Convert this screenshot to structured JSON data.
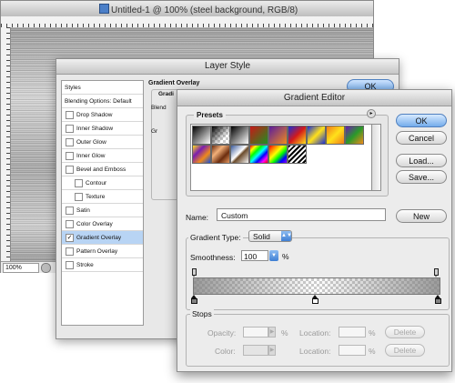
{
  "document": {
    "title": "Untitled-1 @ 100% (steel background, RGB/8)",
    "zoom": "100%"
  },
  "layer_style": {
    "title": "Layer Style",
    "list_header": "Styles",
    "blending_options": "Blending Options: Default",
    "items": [
      {
        "label": "Drop Shadow",
        "checked": false,
        "indent": false
      },
      {
        "label": "Inner Shadow",
        "checked": false,
        "indent": false
      },
      {
        "label": "Outer Glow",
        "checked": false,
        "indent": false
      },
      {
        "label": "Inner Glow",
        "checked": false,
        "indent": false
      },
      {
        "label": "Bevel and Emboss",
        "checked": false,
        "indent": false
      },
      {
        "label": "Contour",
        "checked": false,
        "indent": true
      },
      {
        "label": "Texture",
        "checked": false,
        "indent": true
      },
      {
        "label": "Satin",
        "checked": false,
        "indent": false
      },
      {
        "label": "Color Overlay",
        "checked": false,
        "indent": false
      },
      {
        "label": "Gradient Overlay",
        "checked": true,
        "indent": false,
        "selected": true
      },
      {
        "label": "Pattern Overlay",
        "checked": false,
        "indent": false
      },
      {
        "label": "Stroke",
        "checked": false,
        "indent": false
      }
    ],
    "section_title": "Gradient Overlay",
    "group_title": "Gradi",
    "blend_label": "Blend",
    "gr_label": "Gr",
    "ok_label": "OK"
  },
  "gradient_editor": {
    "title": "Gradient Editor",
    "presets_label": "Presets",
    "presets_menu_glyph": "▸",
    "presets": [
      {
        "name": "Foreground to Background",
        "css": "linear-gradient(135deg,#000,#fff)"
      },
      {
        "name": "Foreground to Transparent",
        "css": "linear-gradient(135deg,#000,rgba(0,0,0,0) 70%), repeating-conic-gradient(#ccc 0 25%,#fff 0 50%) 0 0/6px 6px"
      },
      {
        "name": "Black, White",
        "css": "linear-gradient(135deg,#000,#fff)"
      },
      {
        "name": "Red, Green",
        "css": "linear-gradient(135deg,#c81818,#1f8f1f)"
      },
      {
        "name": "Violet, Orange",
        "css": "linear-gradient(135deg,#5a1d9c,#f08a1d)"
      },
      {
        "name": "Blue, Red, Yellow",
        "css": "linear-gradient(135deg,#1a2fd6,#d41a1a,#ffe11a)"
      },
      {
        "name": "Blue, Yellow, Blue",
        "css": "linear-gradient(135deg,#1a2fd6,#ffe11a,#1a2fd6)"
      },
      {
        "name": "Orange, Yellow, Orange",
        "css": "linear-gradient(135deg,#f07a1a,#ffe11a,#f07a1a)"
      },
      {
        "name": "Violet, Green, Orange",
        "css": "linear-gradient(135deg,#6a1db0,#2a9a2a,#f08a1a)"
      },
      {
        "name": "Yellow, Violet, Orange, Blue",
        "css": "linear-gradient(135deg,#ffe11a,#7a1db0,#f08a1a,#1a4fd6)"
      },
      {
        "name": "Copper",
        "css": "linear-gradient(135deg,#6b2c0e,#f2b07a,#6b2c0e,#e69a62)"
      },
      {
        "name": "Chrome",
        "css": "linear-gradient(135deg,#3a5a9a,#ffffff 45%,#6a4a2a 55%,#f5f5f5)"
      },
      {
        "name": "Spectrum",
        "css": "linear-gradient(135deg,#f00,#ff0,#0f0,#0ff,#00f,#f0f,#f00)"
      },
      {
        "name": "Transparent Rainbow",
        "css": "linear-gradient(135deg,#f00,#f80,#ff0,#0f0,#00f,#80f)"
      },
      {
        "name": "Transparent Stripes",
        "css": "repeating-linear-gradient(135deg,#000 0 2px,#fff 2px 4px)"
      }
    ],
    "buttons": {
      "ok": "OK",
      "cancel": "Cancel",
      "load": "Load...",
      "save": "Save...",
      "new": "New"
    },
    "name_label": "Name:",
    "name_value": "Custom",
    "gradient_type_label": "Gradient Type:",
    "gradient_type_value": "Solid",
    "smoothness_label": "Smoothness:",
    "smoothness_value": "100",
    "smoothness_unit": "%",
    "gradient_colors": [
      "#828282",
      "#ffffff",
      "#828282"
    ],
    "stops": {
      "label": "Stops",
      "opacity_label": "Opacity:",
      "opacity_unit": "%",
      "opacity_location_label": "Location:",
      "opacity_location_unit": "%",
      "delete_label": "Delete",
      "color_label": "Color:",
      "color_location_label": "Location:",
      "color_location_unit": "%",
      "color_delete_label": "Delete"
    }
  }
}
